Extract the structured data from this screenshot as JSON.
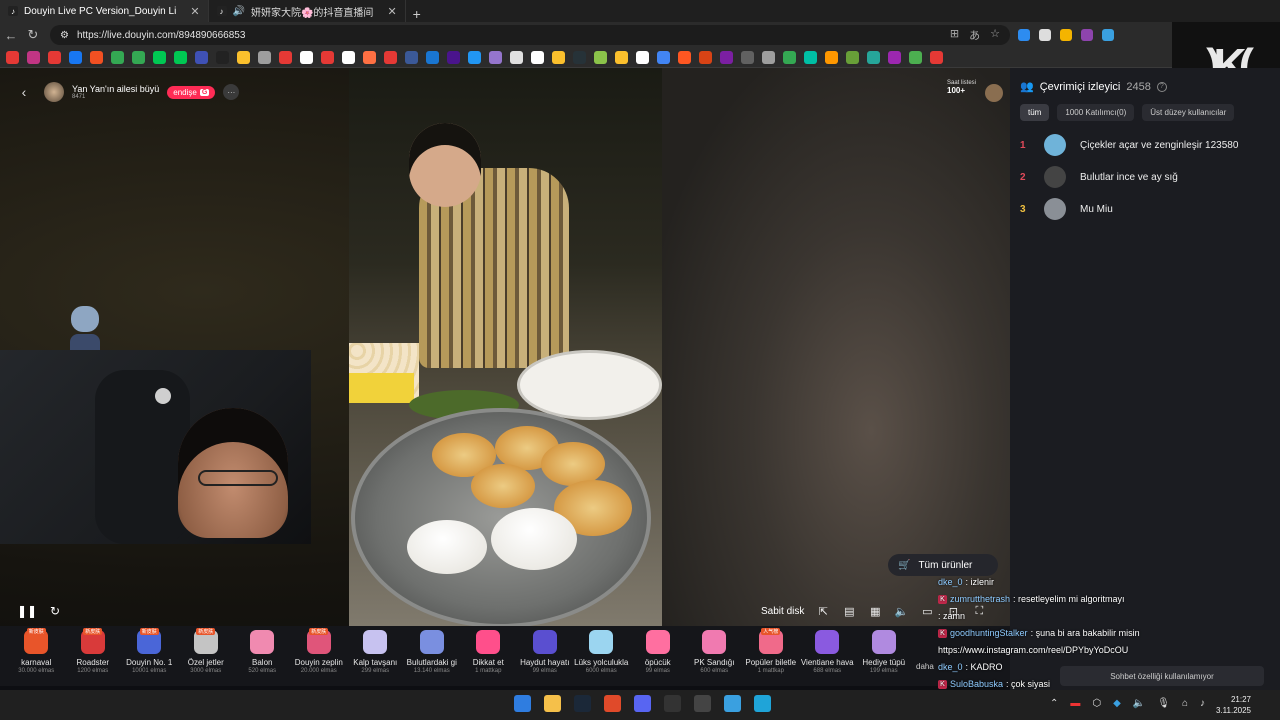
{
  "browser": {
    "tabs": [
      {
        "title": "Douyin Live PC Version_Douyin Li",
        "active": true
      },
      {
        "title": "妍妍家大院🌸的抖音直播间",
        "active": false
      }
    ],
    "url": "https://live.douyin.com/894890666853",
    "bookmark_colors": [
      "#e53935",
      "#c13584",
      "#e53935",
      "#1877f2",
      "#f25022",
      "#34a853",
      "#34a853",
      "#00c853",
      "#00c853",
      "#3f51b5",
      "#222",
      "#fbc02d",
      "#9e9e9e",
      "#e53935",
      "#fff",
      "#e53935",
      "#fff",
      "#ff7043",
      "#e53935",
      "#3b5998",
      "#1976d2",
      "#4a148c",
      "#2196f3",
      "#9575cd",
      "#e0e0e0",
      "#fff",
      "#fbc02d",
      "#263238",
      "#8bc34a",
      "#fbc02d",
      "#fff",
      "#4285f4",
      "#ff5722",
      "#d84315",
      "#7b1fa2",
      "#616161",
      "#9e9e9e",
      "#34a853",
      "#00bfa5",
      "#ff9800",
      "#689f38",
      "#26a69a",
      "#9c27b0",
      "#4caf50",
      "#e53935"
    ]
  },
  "stream": {
    "title": "Yan Yan'ın ailesi büyü",
    "subtitle": "8471",
    "follow_label": "endişe",
    "rank_label": "Saat listesi",
    "rank_value": "100+"
  },
  "controls": {
    "pin_label": "Sabit disk"
  },
  "gifts": [
    {
      "name": "karnaval",
      "price": "30.000 elmas",
      "color": "#e8552a",
      "tag": "新皮肤"
    },
    {
      "name": "Roadster",
      "price": "1200 elmas",
      "color": "#d93a3a",
      "tag": "新皮肤"
    },
    {
      "name": "Douyin No. 1",
      "price": "10001 elmas",
      "color": "#4a66d8",
      "tag": "新皮肤"
    },
    {
      "name": "Özel jetler",
      "price": "3000 elmas",
      "color": "#c4c4c4",
      "tag": "新皮肤"
    },
    {
      "name": "Balon",
      "price": "520 elmas",
      "color": "#f08ab0",
      "tag": ""
    },
    {
      "name": "Douyin zeplin",
      "price": "20.000 elmas",
      "color": "#e0557a",
      "tag": "新皮肤"
    },
    {
      "name": "Kalp tavşanı",
      "price": "299 elmas",
      "color": "#c7c2f0",
      "tag": ""
    },
    {
      "name": "Bulutlardaki gi",
      "price": "13.140 elmas",
      "color": "#7a8fe0",
      "tag": ""
    },
    {
      "name": "Dikkat et",
      "price": "1 mattkap",
      "color": "#ff4f8b",
      "tag": ""
    },
    {
      "name": "Haydut hayatı",
      "price": "99 elmas",
      "color": "#5a4fd0",
      "tag": ""
    },
    {
      "name": "Lüks yolculukla",
      "price": "6000 elmas",
      "color": "#9bd5f0",
      "tag": ""
    },
    {
      "name": "öpücük",
      "price": "99 elmas",
      "color": "#ff6fa0",
      "tag": ""
    },
    {
      "name": "PK Sandığı",
      "price": "600 elmas",
      "color": "#f07ab0",
      "tag": ""
    },
    {
      "name": "Popüler biletle",
      "price": "1 mattkap",
      "color": "#f06a8a",
      "tag": "人气榜"
    },
    {
      "name": "Vientiane hava",
      "price": "688 elmas",
      "color": "#8a5ae0",
      "tag": ""
    },
    {
      "name": "Hediye tüpü",
      "price": "199 elmas",
      "color": "#b08ae0",
      "tag": ""
    }
  ],
  "gifts_more": "daha",
  "panel": {
    "title": "Çevrimiçi izleyici",
    "count": "2458",
    "tabs": [
      "tüm",
      "1000 Katılımcı(0)",
      "Üst düzey kullanıcılar"
    ],
    "viewers": [
      {
        "rank": "1",
        "name": "Çiçekler açar ve zenginleşir 123580",
        "color": "#e04a5a",
        "avatar": "#6fb3d9"
      },
      {
        "rank": "2",
        "name": "Bulutlar ince ve ay sığ",
        "color": "#e04a5a",
        "avatar": "#444"
      },
      {
        "rank": "3",
        "name": "Mu Miu",
        "color": "#f0c040",
        "avatar": "#8a8f96"
      }
    ]
  },
  "products_label": "Tüm ürünler",
  "chat": [
    {
      "user": "dke_0",
      "text": ": izlenir",
      "badge": ""
    },
    {
      "user": "zumrutthetrash",
      "text": ": resetleyelim mi algoritmayı",
      "badge": "K"
    },
    {
      "user": "",
      "text": ": zamn",
      "badge": ""
    },
    {
      "user": "goodhuntingStalker",
      "text": ": şuna bi ara bakabilir misin",
      "badge": "K"
    },
    {
      "user": "",
      "text": "https://www.instagram.com/reel/DPYbyYoDcOU",
      "badge": ""
    },
    {
      "user": "dke_0",
      "text": ": KADRO",
      "badge": ""
    },
    {
      "user": "SuloBabuska",
      "text": ": çok siyasi",
      "badge": "K"
    }
  ],
  "chat_notice": "Sohbet özelliği kullanılamıyor",
  "taskbar": {
    "apps": [
      "#2f7de0",
      "#f5c04a",
      "#1b2838",
      "#e04a2a",
      "#5865f2",
      "#333",
      "#444",
      "#3aa0e0",
      "#1fa4d8"
    ],
    "time": "21:27",
    "date": "3.11.2025"
  }
}
